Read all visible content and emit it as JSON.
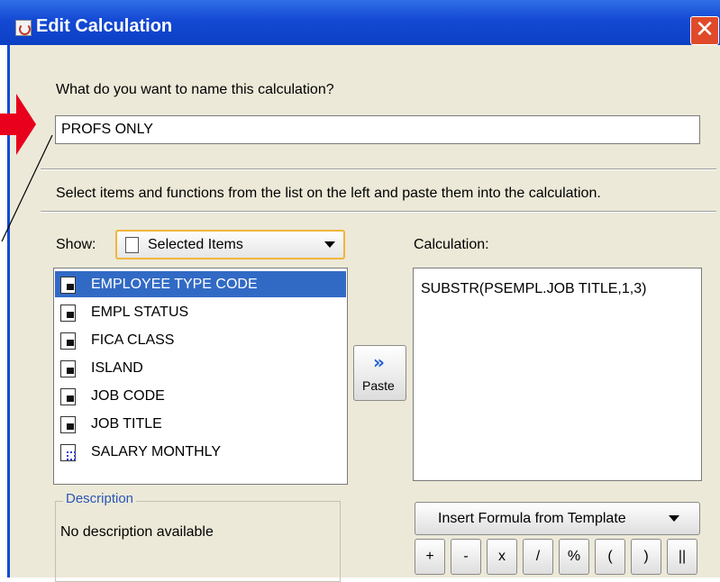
{
  "window": {
    "title": "Edit Calculation",
    "close_glyph": "✕"
  },
  "name_section": {
    "prompt": "What do you want to name this calculation?",
    "value": "PROFS ONLY"
  },
  "instruction": "Select items and functions from the list on the left and paste them into the calculation.",
  "show": {
    "label": "Show:",
    "selected": "Selected Items"
  },
  "items": [
    {
      "label": "EMPLOYEE TYPE CODE",
      "icon": "text-item-icon",
      "selected": true
    },
    {
      "label": "EMPL STATUS",
      "icon": "text-item-icon",
      "selected": false
    },
    {
      "label": "FICA CLASS",
      "icon": "text-item-icon",
      "selected": false
    },
    {
      "label": "ISLAND",
      "icon": "text-item-icon",
      "selected": false
    },
    {
      "label": "JOB CODE",
      "icon": "text-item-icon",
      "selected": false
    },
    {
      "label": "JOB TITLE",
      "icon": "text-item-icon",
      "selected": false
    },
    {
      "label": "SALARY MONTHLY",
      "icon": "numeric-item-icon",
      "selected": false
    }
  ],
  "paste": {
    "label": "Paste",
    "icon": "chevron-right-icon"
  },
  "calculation": {
    "label": "Calculation:",
    "value": "SUBSTR(PSEMPL.JOB TITLE,1,3)"
  },
  "description": {
    "legend": "Description",
    "text": "No description available"
  },
  "template_button": {
    "label": "Insert Formula from Template"
  },
  "operators": [
    "+",
    "-",
    "x",
    "/",
    "%",
    "(",
    ")",
    "||"
  ],
  "colors": {
    "title_bar": "#1449d4",
    "selection": "#316ac5",
    "annotation_arrow": "#e8001c",
    "dialog_bg": "#ece9d8"
  }
}
